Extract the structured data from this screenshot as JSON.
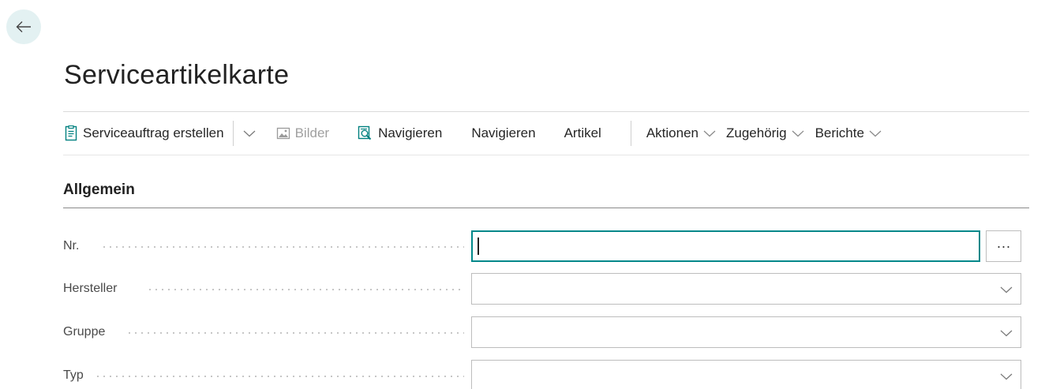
{
  "page": {
    "title": "Serviceartikelkarte"
  },
  "action_bar": {
    "create_order_label": "Serviceauftrag erstellen",
    "pictures_label": "Bilder",
    "navigate_icon_label": "Navigieren",
    "navigate_label": "Navigieren",
    "item_label": "Artikel",
    "actions_label": "Aktionen",
    "related_label": "Zugehörig",
    "reports_label": "Berichte"
  },
  "section": {
    "title": "Allgemein"
  },
  "fields": [
    {
      "label": "Nr.",
      "value": ""
    },
    {
      "label": "Hersteller",
      "value": ""
    },
    {
      "label": "Gruppe",
      "value": ""
    },
    {
      "label": "Typ",
      "value": ""
    }
  ],
  "lookup": {
    "label": "···"
  },
  "colors": {
    "accent": "#00888a",
    "back_button_bg": "#e3f1f2",
    "disabled_text": "#a0a0a0"
  },
  "icons": {
    "back": "arrow-left-icon",
    "create_order": "document-icon",
    "pictures": "picture-icon",
    "navigate": "search-document-icon",
    "dropdown": "chevron-down-icon"
  }
}
